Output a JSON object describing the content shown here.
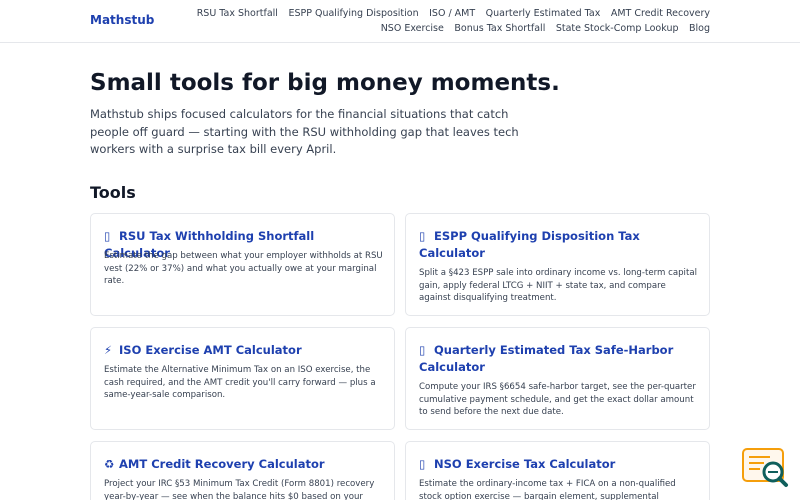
{
  "header": {
    "brand": "Mathstub",
    "nav": [
      "RSU Tax Shortfall",
      "ESPP Qualifying Disposition",
      "ISO / AMT",
      "Quarterly Estimated Tax",
      "AMT Credit Recovery",
      "NSO Exercise",
      "Bonus Tax Shortfall",
      "State Stock-Comp Lookup",
      "Blog"
    ]
  },
  "hero": {
    "title": "Small tools for big money moments.",
    "subtitle": "Mathstub ships focused calculators for the financial situations that catch people off guard — starting with the RSU withholding gap that leaves tech workers with a surprise tax bill every April."
  },
  "tools": {
    "heading": "Tools",
    "cards": [
      {
        "icon": "▯",
        "icon_name": "chart-icon",
        "title": "RSU Tax Withholding Shortfall Calculator",
        "desc": "Estimate the gap between what your employer withholds at RSU vest (22% or 37%) and what you actually owe at your marginal rate."
      },
      {
        "icon": "▯",
        "icon_name": "chart-icon",
        "title": "ESPP Qualifying Disposition Tax Calculator",
        "desc": "Split a §423 ESPP sale into ordinary income vs. long-term capital gain, apply federal LTCG + NIIT + state tax, and compare against disqualifying treatment."
      },
      {
        "icon": "⚡",
        "icon_name": "lightning-icon",
        "title": "ISO Exercise AMT Calculator",
        "desc": "Estimate the Alternative Minimum Tax on an ISO exercise, the cash required, and the AMT credit you'll carry forward — plus a same-year-sale comparison."
      },
      {
        "icon": "▯",
        "icon_name": "calendar-icon",
        "title": "Quarterly Estimated Tax Safe-Harbor Calculator",
        "desc": "Compute your IRS §6654 safe-harbor target, see the per-quarter cumulative payment schedule, and get the exact dollar amount to send before the next due date."
      },
      {
        "icon": "♻",
        "icon_name": "recycle-icon",
        "title": "AMT Credit Recovery Calculator",
        "desc": "Project your IRC §53 Minimum Tax Credit (Form 8801) recovery year-by-year — see when the balance hits $0 based on your"
      },
      {
        "icon": "▯",
        "icon_name": "document-icon",
        "title": "NSO Exercise Tax Calculator",
        "desc": "Estimate the ordinary-income tax + FICA on a non-qualified stock option exercise — bargain element, supplemental"
      }
    ]
  },
  "colors": {
    "brand": "#1e40af",
    "widget_orange": "#f59e0b",
    "widget_teal": "#0f5f5c"
  }
}
